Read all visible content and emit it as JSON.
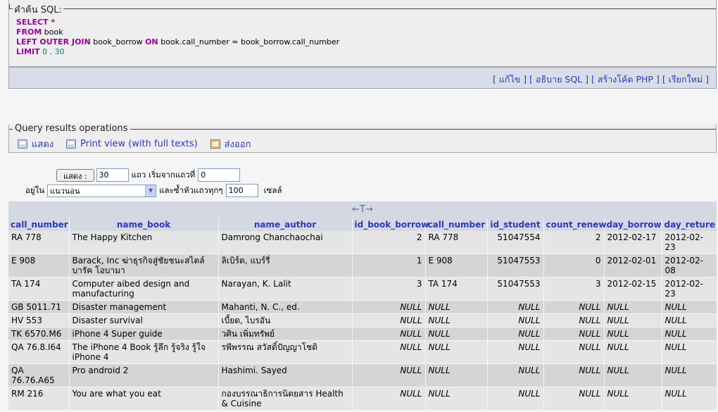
{
  "sql_query": {
    "legend": "คำค้น SQL:",
    "lines": [
      [
        {
          "t": "SELECT",
          "c": "kw"
        },
        {
          "t": " *",
          "c": "kw"
        }
      ],
      [
        {
          "t": "FROM",
          "c": "kw"
        },
        {
          "t": " book",
          "c": "txt"
        }
      ],
      [
        {
          "t": "LEFT OUTER JOIN",
          "c": "kw"
        },
        {
          "t": " book_borrow ",
          "c": "txt"
        },
        {
          "t": "ON",
          "c": "kw"
        },
        {
          "t": " book.call_number = book_borrow.call_number",
          "c": "txt"
        }
      ],
      [
        {
          "t": "LIMIT",
          "c": "kw"
        },
        {
          "t": " 0 , 30",
          "c": "num"
        }
      ]
    ]
  },
  "sql_links": [
    "แก้ไข",
    "อธิบาย SQL",
    "สร้างโค้ด PHP",
    "เรียกใหม่"
  ],
  "operations": {
    "legend": "Query results operations",
    "items": [
      {
        "label": "แสดง",
        "icon": "print-icon"
      },
      {
        "label": "Print view (with full texts)",
        "icon": "print-icon"
      },
      {
        "label": "ส่งออก",
        "icon": "export-icon"
      }
    ]
  },
  "nav_form": {
    "show_button": "แสดง :",
    "rows_value": "30",
    "rows_label": "แถว เริ่มจากแถวที่",
    "start_value": "0",
    "in_label": "อยู่ใน",
    "mode_value": "แนวนอน",
    "repeat_label": "และซ้ำหัวแถวทุกๆ",
    "repeat_value": "100",
    "cells_label": "เซลล์"
  },
  "table": {
    "arrows": "←T→",
    "columns": [
      "call_number",
      "name_book",
      "name_author",
      "id_book_borrow",
      "call_number",
      "id_student",
      "count_renew",
      "day_borrow",
      "day_reture"
    ],
    "rows": [
      [
        "RA 778",
        "The Happy Kitchen",
        "Damrong Chanchaochai",
        "2",
        "RA 778",
        "51047554",
        "2",
        "2012-02-17",
        "2012-02-23"
      ],
      [
        "E 908",
        "Barack, Inc ฆ่าธุรกิจสู่ชัยชนะสไตล์ บารัค โอบามา",
        "ลิเบิร์ต, แบร์รี่",
        "1",
        "E 908",
        "51047553",
        "0",
        "2012-02-01",
        "2012-02-08"
      ],
      [
        "TA 174",
        "Computer aibed design and manufacturing",
        "Narayan, K. Lalit",
        "3",
        "TA 174",
        "51047553",
        "3",
        "2012-02-15",
        "2012-02-23"
      ],
      [
        "GB 5011.71",
        "Disaster management",
        "Mahanti, N. C., ed.",
        "NULL",
        "NULL",
        "NULL",
        "NULL",
        "NULL",
        "NULL"
      ],
      [
        "HV 553",
        "Disaster survival",
        "เบี้ยด, ไบรอัน",
        "NULL",
        "NULL",
        "NULL",
        "NULL",
        "NULL",
        "NULL"
      ],
      [
        "TK 6570.M6",
        "iPhone 4 Super guide",
        "วศิน เพิ่มทรัพย์",
        "NULL",
        "NULL",
        "NULL",
        "NULL",
        "NULL",
        "NULL"
      ],
      [
        "QA 76.8.I64",
        "The iPhone 4 Book รู้ลึก รู้จริง รู้ใจ iPhone 4",
        "รพีพรรณ สวัสดิ์ปัญญาโชติ",
        "NULL",
        "NULL",
        "NULL",
        "NULL",
        "NULL",
        "NULL"
      ],
      [
        "QA 76.76.A65",
        "Pro android 2",
        "Hashimi. Sayed",
        "NULL",
        "NULL",
        "NULL",
        "NULL",
        "NULL",
        "NULL"
      ],
      [
        "RM 216",
        "You are what you eat",
        "กองบรรณาธิการนิตยสาร Health & Cuisine",
        "NULL",
        "NULL",
        "NULL",
        "NULL",
        "NULL",
        "NULL"
      ]
    ]
  }
}
